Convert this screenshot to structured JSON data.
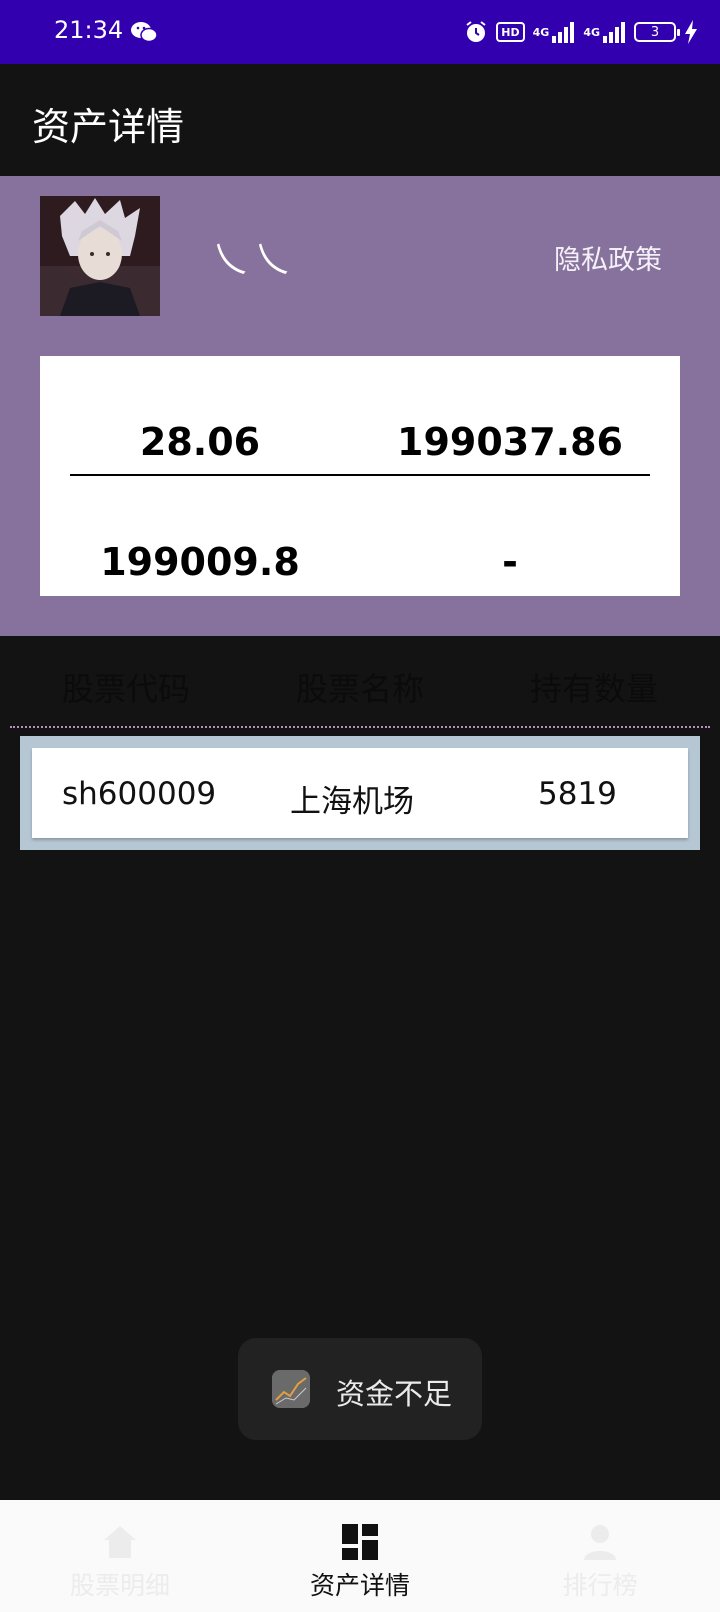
{
  "status_bar": {
    "time": "21:34",
    "hd_label": "HD",
    "net1": "4G",
    "net2": "4G",
    "battery": "3"
  },
  "app_bar": {
    "title": "资产详情"
  },
  "profile": {
    "username": "乀乀",
    "privacy": "隐私政策"
  },
  "summary": {
    "value1": "28.06",
    "value2": "199037.86",
    "value3": "199009.8",
    "value4": "-"
  },
  "table": {
    "headers": [
      "股票代码",
      "股票名称",
      "持有数量"
    ],
    "rows": [
      {
        "code": "sh600009",
        "name": "上海机场",
        "quantity": "5819"
      }
    ]
  },
  "toast": {
    "message": "资金不足"
  },
  "bottom_nav": {
    "items": [
      {
        "label": "股票明细",
        "icon": "home-icon",
        "active": false
      },
      {
        "label": "资产详情",
        "icon": "dashboard-icon",
        "active": true
      },
      {
        "label": "排行榜",
        "icon": "person-icon",
        "active": false
      }
    ]
  },
  "colors": {
    "status_bar": "#3300b0",
    "profile_bg": "#86729c",
    "background": "#131313",
    "row_border": "#b6c7d4"
  }
}
